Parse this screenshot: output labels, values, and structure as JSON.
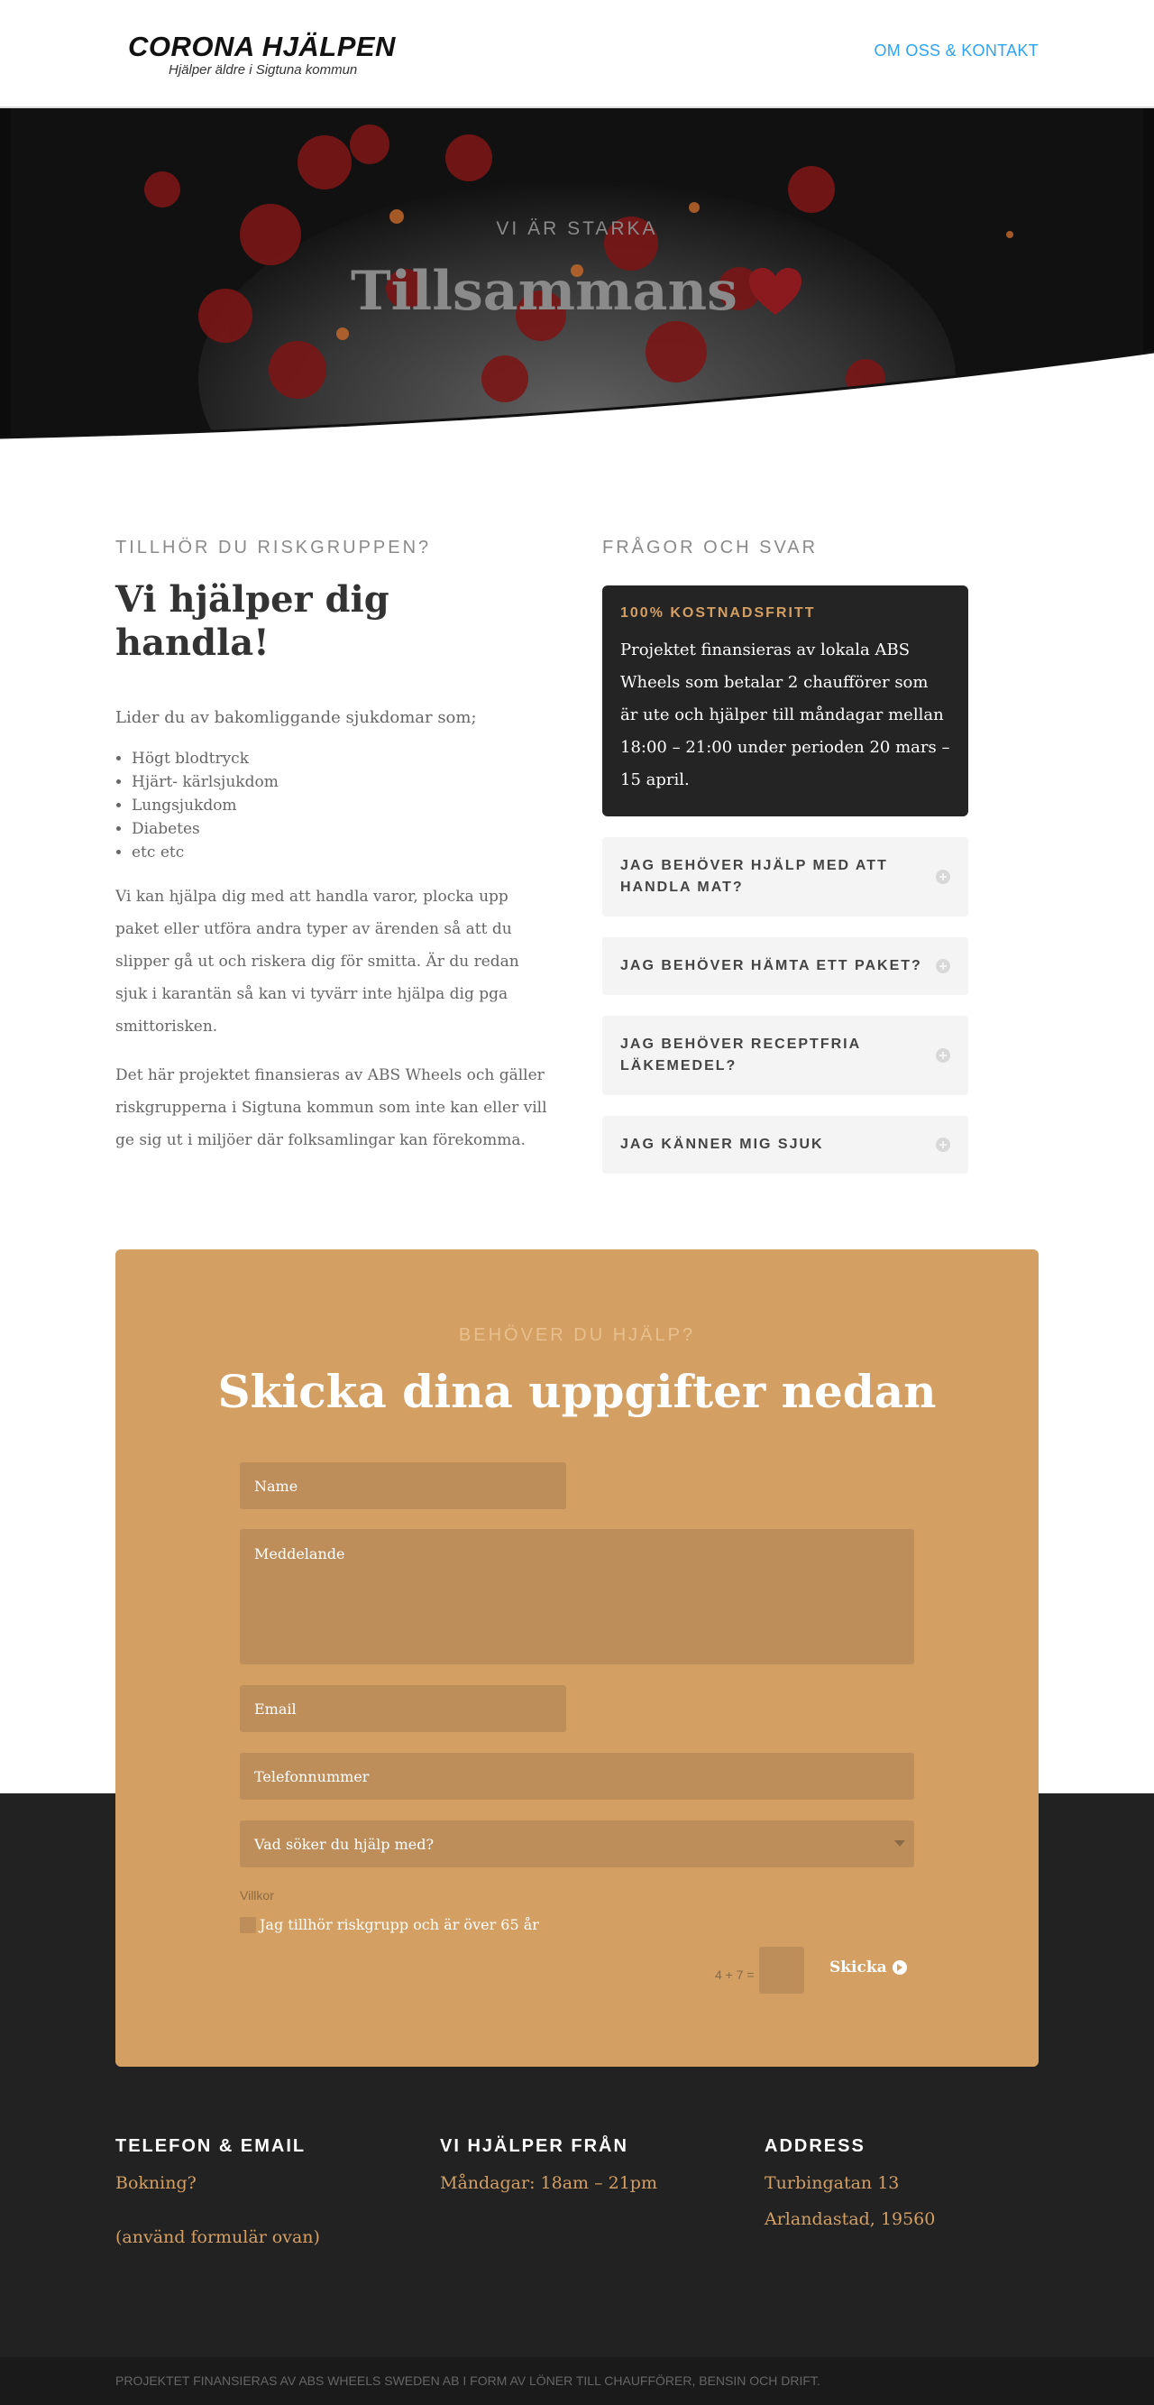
{
  "header": {
    "logo_title": "CORONA HJÄLPEN",
    "logo_subtitle": "Hjälper äldre i Sigtuna kommun",
    "nav_link": "OM OSS & KONTAKT"
  },
  "hero": {
    "kicker": "VI ÄR STARKA",
    "title": "Tillsammans",
    "heart_color": "#8b1a1f"
  },
  "left": {
    "label": "TILLHÖR DU RISKGRUPPEN?",
    "heading": "Vi hjälper dig handla!",
    "intro": "Lider du av bakomliggande sjukdomar som;",
    "bullets": [
      "Högt blodtryck",
      "Hjärt- kärlsjukdom",
      "Lungsjukdom",
      "Diabetes",
      "etc etc"
    ],
    "para1": "Vi kan hjälpa dig med att handla varor, plocka upp paket eller utföra andra typer av ärenden så att du slipper gå ut och riskera dig för smitta. Är du redan sjuk i karantän så kan vi tyvärr inte hjälpa dig pga smittorisken.",
    "para2": "Det här projektet finansieras av ABS Wheels och gäller riskgrupperna i Sigtuna kommun som inte kan eller vill ge sig ut i miljöer där folksamlingar kan förekomma."
  },
  "faq": {
    "label": "FRÅGOR OCH SVAR",
    "open_title": "100% KOSTNADSFRITT",
    "open_body": "Projektet finansieras av lokala ABS Wheels som betalar 2 chaufförer som är ute och hjälper till måndagar mellan 18:00 – 21:00 under perioden 20 mars – 15 april.",
    "items": [
      "JAG BEHÖVER HJÄLP MED ATT HANDLA MAT?",
      "JAG BEHÖVER HÄMTA ETT PAKET?",
      "JAG BEHÖVER RECEPTFRIA LÄKEMEDEL?",
      "JAG KÄNNER MIG SJUK"
    ]
  },
  "form": {
    "kicker": "BEHÖVER DU HJÄLP?",
    "title": "Skicka dina uppgifter nedan",
    "name_placeholder": "Name",
    "message_placeholder": "Meddelande",
    "email_placeholder": "Email",
    "phone_placeholder": "Telefonnummer",
    "select_value": "Vad söker du hjälp med?",
    "terms_label": "Villkor",
    "checkbox_label": "Jag tillhör riskgrupp och är över 65 år",
    "captcha": "4 + 7 =",
    "submit": "Skicka",
    "card_color": "#d39f63"
  },
  "footer": {
    "col1_heading": "TELEFON & EMAIL",
    "col1_line1": "Bokning?",
    "col1_line2": "(använd formulär ovan)",
    "col2_heading": "VI HJÄLPER FRÅN",
    "col2_line1": "Måndagar: 18am – 21pm",
    "col3_heading": "ADDRESS",
    "col3_line1": "Turbingatan 13",
    "col3_line2": "Arlandastad, 19560",
    "bottom": "PROJEKTET FINANSIERAS AV ABS WHEELS SWEDEN AB I FORM AV LÖNER TILL CHAUFFÖRER, BENSIN OCH DRIFT."
  }
}
